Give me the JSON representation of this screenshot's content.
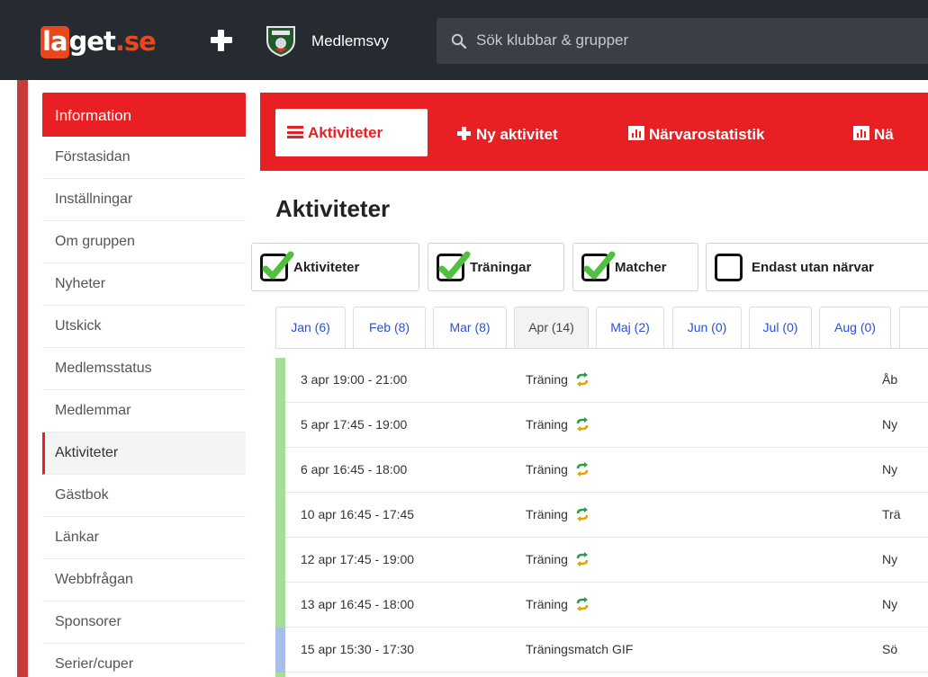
{
  "header": {
    "logo": {
      "part1": "la",
      "part2": "get",
      "part3": ".se"
    },
    "member_view": "Medlemsvy",
    "search": {
      "placeholder": "Sök klubbar & grupper"
    }
  },
  "sidebar": {
    "heading": "Information",
    "items": [
      {
        "label": "Förstasidan"
      },
      {
        "label": "Inställningar"
      },
      {
        "label": "Om gruppen"
      },
      {
        "label": "Nyheter"
      },
      {
        "label": "Utskick"
      },
      {
        "label": "Medlemsstatus"
      },
      {
        "label": "Medlemmar"
      },
      {
        "label": "Aktiviteter"
      },
      {
        "label": "Gästbok"
      },
      {
        "label": "Länkar"
      },
      {
        "label": "Webbfrågan"
      },
      {
        "label": "Sponsorer"
      },
      {
        "label": "Serier/cuper"
      }
    ],
    "active_item": "Aktiviteter"
  },
  "toolbar": {
    "activities": "Aktiviteter",
    "new_activity": "Ny aktivitet",
    "attendance_stats": "Närvarostatistik",
    "next_truncated": "Nä"
  },
  "page": {
    "title": "Aktiviteter"
  },
  "filters": [
    {
      "label": "Aktiviteter",
      "checked": true
    },
    {
      "label": "Träningar",
      "checked": true
    },
    {
      "label": "Matcher",
      "checked": true
    },
    {
      "label": "Endast utan närvar",
      "checked": false
    }
  ],
  "months": [
    {
      "label": "Jan (6)"
    },
    {
      "label": "Feb (8)"
    },
    {
      "label": "Mar (8)"
    },
    {
      "label": "Apr (14)",
      "active": true
    },
    {
      "label": "Maj (2)"
    },
    {
      "label": "Jun (0)"
    },
    {
      "label": "Jul (0)"
    },
    {
      "label": "Aug (0)"
    }
  ],
  "activities": [
    {
      "time": "3 apr 19:00 - 21:00",
      "type": "Träning",
      "location": "Åb",
      "color": "#a6dd98"
    },
    {
      "time": "5 apr 17:45 - 19:00",
      "type": "Träning",
      "location": "Ny",
      "color": "#a6dd98"
    },
    {
      "time": "6 apr 16:45 - 18:00",
      "type": "Träning",
      "location": "Ny",
      "color": "#a6dd98"
    },
    {
      "time": "10 apr 16:45 - 17:45",
      "type": "Träning",
      "location": "Trä",
      "color": "#a6dd98"
    },
    {
      "time": "12 apr 17:45 - 19:00",
      "type": "Träning",
      "location": "Ny",
      "color": "#a6dd98"
    },
    {
      "time": "13 apr 16:45 - 18:00",
      "type": "Träning",
      "location": "Ny",
      "color": "#a6dd98"
    },
    {
      "time": "15 apr 15:30 - 17:30",
      "type": "Träningsmatch GIF",
      "location": "Sö",
      "color": "#a9bfe8"
    }
  ],
  "colors": {
    "brand_red": "#e82023",
    "topbar": "#262a31",
    "link_blue": "#2a4fd6",
    "logo_orange": "#e8481c"
  },
  "icons": [
    "plus-icon",
    "club-logo",
    "search-icon",
    "hamburger-icon",
    "stat-icon",
    "checkbox-checked",
    "checkbox-empty",
    "sync-icon"
  ]
}
